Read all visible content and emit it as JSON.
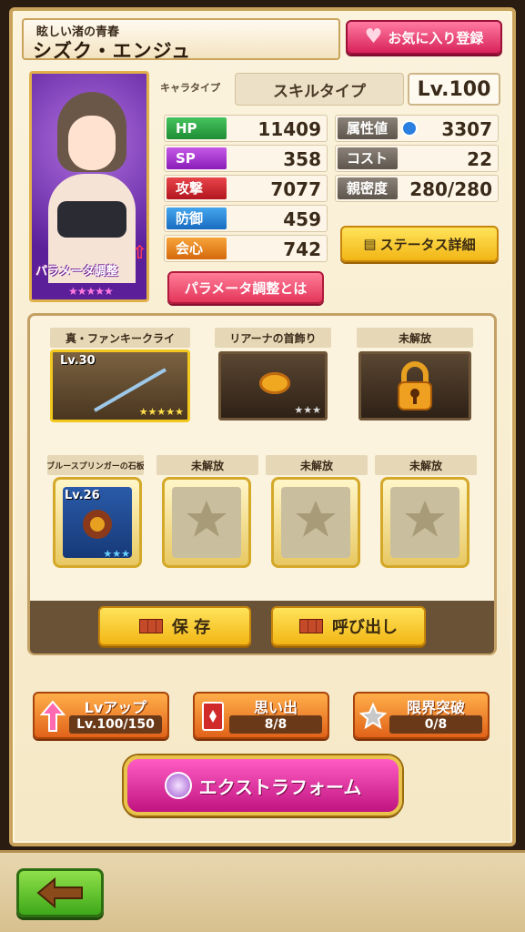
{
  "header": {
    "subtitle": "眩しい渚の青春",
    "name": "シズク・エンジュ",
    "favorite_label": "お気に入り登録"
  },
  "portrait": {
    "param_label": "パラメータ調整",
    "stars": "★★★★★"
  },
  "info": {
    "chara_type_label": "キャラタイプ",
    "chara_type_value": "スキルタイプ",
    "level": "Lv.100"
  },
  "stats_left": [
    {
      "label": "HP",
      "value": "11409"
    },
    {
      "label": "SP",
      "value": "358"
    },
    {
      "label": "攻撃",
      "value": "7077"
    },
    {
      "label": "防御",
      "value": "459"
    },
    {
      "label": "会心",
      "value": "742"
    }
  ],
  "stats_right": [
    {
      "label": "属性値",
      "value": "3307"
    },
    {
      "label": "コスト",
      "value": "22"
    },
    {
      "label": "親密度",
      "value": "280/280"
    }
  ],
  "buttons": {
    "status_detail": "ステータス詳細",
    "param_about": "パラメータ調整とは",
    "save": "保 存",
    "load": "呼び出し",
    "extra_form": "エクストラフォーム"
  },
  "equipment": {
    "weapon": {
      "title": "真・ファンキークライ",
      "level": "Lv.30",
      "stars": "★★★★★"
    },
    "accessory": {
      "title": "リアーナの首飾り",
      "stars": "★★★"
    },
    "locked_title": "未解放",
    "tablet": {
      "title": "ブルースプリンガーの石板",
      "level": "Lv.26",
      "stars": "★★★"
    },
    "sub_locked": [
      "未解放",
      "未解放",
      "未解放"
    ]
  },
  "actions": {
    "lvup": {
      "title": "Lvアップ",
      "value": "Lv.100/150"
    },
    "memory": {
      "title": "思い出",
      "value": "8/8"
    },
    "limit": {
      "title": "限界突破",
      "value": "0/8"
    }
  }
}
